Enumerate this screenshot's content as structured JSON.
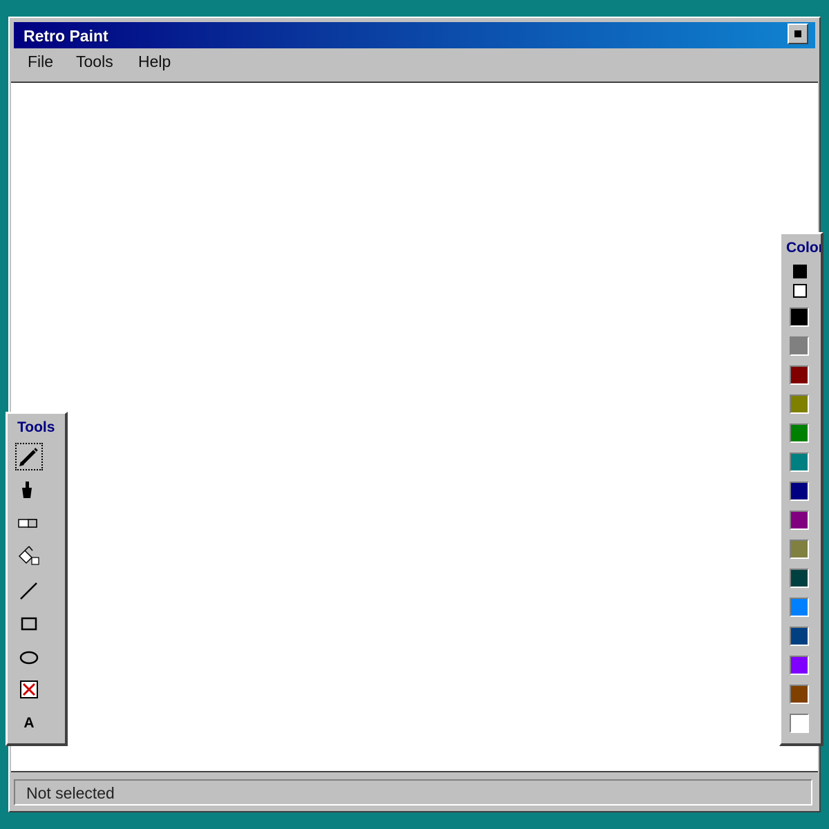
{
  "window": {
    "title": "Retro Paint"
  },
  "menu": {
    "items": [
      "File",
      "Tools",
      "Help"
    ]
  },
  "tools_panel": {
    "title": "Tools",
    "tools": [
      {
        "name": "pencil",
        "icon": "pencil-icon",
        "selected": true
      },
      {
        "name": "brush",
        "icon": "brush-icon",
        "selected": false
      },
      {
        "name": "eraser",
        "icon": "eraser-icon",
        "selected": false
      },
      {
        "name": "fill",
        "icon": "fill-bucket-icon",
        "selected": false
      },
      {
        "name": "line",
        "icon": "line-icon",
        "selected": false
      },
      {
        "name": "rectangle",
        "icon": "rectangle-icon",
        "selected": false
      },
      {
        "name": "ellipse",
        "icon": "ellipse-icon",
        "selected": false
      },
      {
        "name": "clear",
        "icon": "clear-canvas-icon",
        "selected": false
      },
      {
        "name": "text",
        "icon": "text-icon",
        "label": "A",
        "selected": false
      }
    ]
  },
  "colors_panel": {
    "title": "Colors",
    "foreground": "#000000",
    "background": "#ffffff",
    "palette": [
      "#000000",
      "#808080",
      "#800000",
      "#808000",
      "#008000",
      "#008080",
      "#000080",
      "#800080",
      "#808040",
      "#004040",
      "#0080ff",
      "#004080",
      "#8000ff",
      "#804000",
      "#ffffff"
    ]
  },
  "status": {
    "text": "Not selected"
  }
}
